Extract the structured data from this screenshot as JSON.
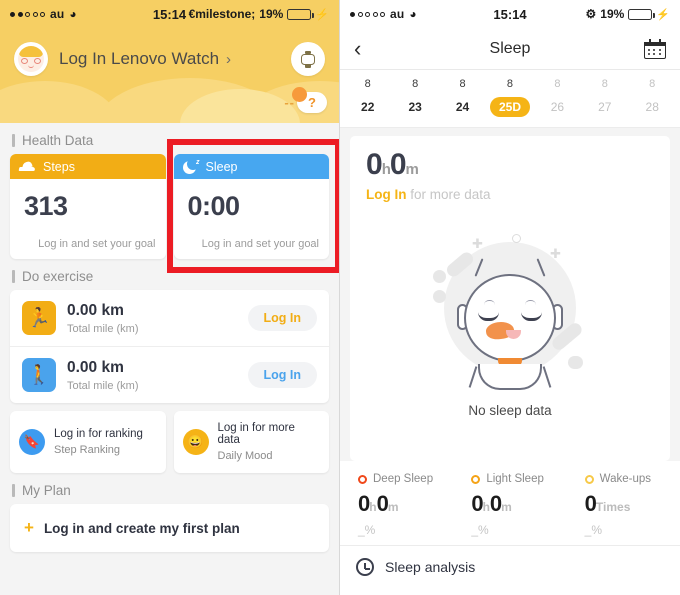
{
  "left": {
    "status": {
      "signal_filled": 2,
      "signal_total": 5,
      "carrier": "au",
      "wifi_icon": "wifi-icon",
      "time": "15:14",
      "bluetooth_icon": "bluetooth-icon",
      "battery_percent": "19%",
      "battery_level": 19,
      "charging_icon": "lightning-bolt-icon"
    },
    "hero": {
      "avatar_icon": "user-avatar",
      "title": "Log In Lenovo Watch",
      "chevron": "›",
      "watch_icon": "watch-icon",
      "help_dash": "--",
      "help_mark": "?"
    },
    "sections": {
      "health": "Health Data",
      "exercise": "Do exercise",
      "plan": "My Plan"
    },
    "health_cards": [
      {
        "icon": "shoe-icon",
        "title": "Steps",
        "value": "313",
        "sub": "Log in and set your goal",
        "header_color": "#f2ad15"
      },
      {
        "icon": "moon-icon",
        "title": "Sleep",
        "value": "0:00",
        "sub": "Log in and set your goal",
        "header_color": "#47a7f0"
      }
    ],
    "exercise_rows": [
      {
        "icon": "running-icon",
        "value": "0.00 km",
        "caption": "Total mile (km)",
        "button": "Log In",
        "color": "#f2ad15"
      },
      {
        "icon": "hiking-icon",
        "value": "0.00 km",
        "caption": "Total mile (km)",
        "button": "Log In",
        "color": "#4aa3ec"
      }
    ],
    "mini_cards": [
      {
        "icon": "bookmark-badge-icon",
        "line1": "Log in for ranking",
        "line2": "Step Ranking"
      },
      {
        "icon": "smiley-face-icon",
        "line1": "Log in for more data",
        "line2": "Daily Mood"
      }
    ],
    "plan": {
      "plus": "+",
      "label": "Log in and create my first plan"
    },
    "highlight_color": "#ec1c24"
  },
  "right": {
    "status": {
      "signal_filled": 1,
      "signal_total": 5,
      "carrier": "au",
      "wifi_icon": "wifi-icon",
      "time": "15:14",
      "bluetooth_icon": "bluetooth-icon",
      "battery_percent": "19%",
      "battery_level": 19,
      "charging_icon": "lightning-bolt-icon"
    },
    "nav": {
      "back_icon": "back-chevron-icon",
      "title": "Sleep",
      "calendar_icon": "calendar-icon"
    },
    "dates": [
      {
        "month": "8",
        "day": "22",
        "active": false,
        "dim": false
      },
      {
        "month": "8",
        "day": "23",
        "active": false,
        "dim": false
      },
      {
        "month": "8",
        "day": "24",
        "active": false,
        "dim": false
      },
      {
        "month": "8",
        "day": "25D",
        "active": true,
        "dim": false
      },
      {
        "month": "8",
        "day": "26",
        "active": false,
        "dim": true
      },
      {
        "month": "8",
        "day": "27",
        "active": false,
        "dim": true
      },
      {
        "month": "8",
        "day": "28",
        "active": false,
        "dim": true
      }
    ],
    "summary": {
      "hours": "0",
      "hours_unit": "h",
      "minutes": "0",
      "minutes_unit": "m",
      "login_link": "Log In",
      "login_rest": " for more data"
    },
    "empty_state": {
      "illustration": "sleeping-mascot-illustration",
      "label": "No sleep data"
    },
    "stats": [
      {
        "label": "Deep Sleep",
        "ring_color": "#f0481a",
        "value_a": "0",
        "unit_a": "h",
        "value_b": "0",
        "unit_b": "m",
        "percent": "_%"
      },
      {
        "label": "Light Sleep",
        "ring_color": "#f5a316",
        "value_a": "0",
        "unit_a": "h",
        "value_b": "0",
        "unit_b": "m",
        "percent": "_%"
      },
      {
        "label": "Wake-ups",
        "ring_color": "#f7c948",
        "value_a": "0",
        "unit_a": "Times",
        "value_b": "",
        "unit_b": "",
        "percent": "_%"
      }
    ],
    "analysis": {
      "icon": "clock-icon",
      "label": "Sleep analysis"
    },
    "accent_color": "#f5b416"
  }
}
